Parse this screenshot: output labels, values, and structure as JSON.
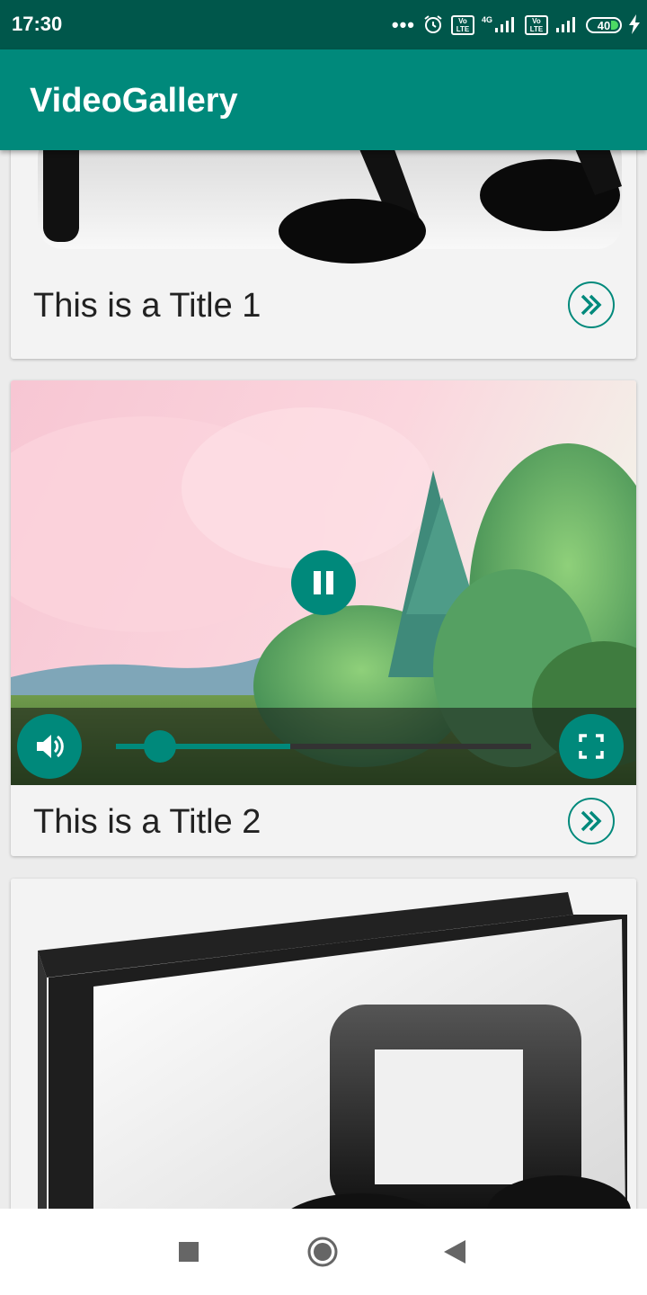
{
  "status_bar": {
    "time": "17:30",
    "network_label": "4G",
    "volte_label": "Vo LTE",
    "battery_level": "40",
    "icons": [
      "more-dots-icon",
      "alarm-icon",
      "volte-icon",
      "signal-icon",
      "battery-icon",
      "charging-icon"
    ]
  },
  "app_bar": {
    "title": "VideoGallery"
  },
  "cards": [
    {
      "title": "This is a Title 1",
      "media": "music-thumbnail"
    },
    {
      "title": "This is a Title 2",
      "media": "video-player"
    },
    {
      "title": "",
      "media": "music-thumbnail"
    }
  ],
  "player": {
    "state": "playing",
    "progress": 0.42,
    "buffered": 0.42
  },
  "nav_bar": {
    "buttons": [
      "recents-button",
      "home-button",
      "back-button"
    ]
  },
  "colors": {
    "primary": "#00897b",
    "primary_dark": "#00574b"
  }
}
